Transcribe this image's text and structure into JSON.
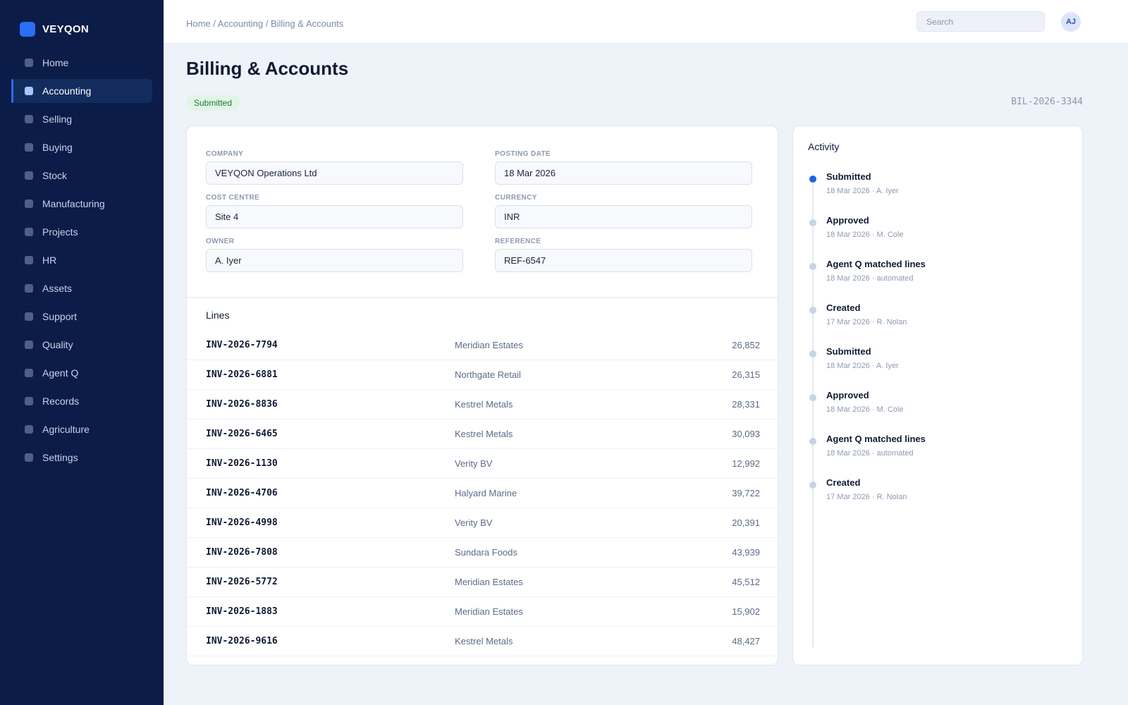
{
  "brand": {
    "name": "VEYQON"
  },
  "sidebar": {
    "items": [
      {
        "label": "Home"
      },
      {
        "label": "Accounting"
      },
      {
        "label": "Selling"
      },
      {
        "label": "Buying"
      },
      {
        "label": "Stock"
      },
      {
        "label": "Manufacturing"
      },
      {
        "label": "Projects"
      },
      {
        "label": "HR"
      },
      {
        "label": "Assets"
      },
      {
        "label": "Support"
      },
      {
        "label": "Quality"
      },
      {
        "label": "Agent Q"
      },
      {
        "label": "Records"
      },
      {
        "label": "Agriculture"
      },
      {
        "label": "Settings"
      }
    ],
    "active_index": 1
  },
  "topbar": {
    "breadcrumb": "Home / Accounting / Billing & Accounts",
    "search_placeholder": "Search",
    "avatar_initials": "AJ"
  },
  "page": {
    "title": "Billing & Accounts",
    "status": "Submitted",
    "doc_id": "BIL-2026-3344"
  },
  "form": {
    "company_label": "COMPANY",
    "company_value": "VEYQON Operations Ltd",
    "posting_date_label": "POSTING DATE",
    "posting_date_value": "18 Mar 2026",
    "cost_centre_label": "COST CENTRE",
    "cost_centre_value": "Site 4",
    "currency_label": "CURRENCY",
    "currency_value": "INR",
    "owner_label": "OWNER",
    "owner_value": "A. Iyer",
    "reference_label": "REFERENCE",
    "reference_value": "REF-6547"
  },
  "lines": {
    "title": "Lines",
    "rows": [
      {
        "invoice": "INV-2026-7794",
        "customer": "Meridian Estates",
        "amount": "26,852"
      },
      {
        "invoice": "INV-2026-6881",
        "customer": "Northgate Retail",
        "amount": "26,315"
      },
      {
        "invoice": "INV-2026-8836",
        "customer": "Kestrel Metals",
        "amount": "28,331"
      },
      {
        "invoice": "INV-2026-6465",
        "customer": "Kestrel Metals",
        "amount": "30,093"
      },
      {
        "invoice": "INV-2026-1130",
        "customer": "Verity BV",
        "amount": "12,992"
      },
      {
        "invoice": "INV-2026-4706",
        "customer": "Halyard Marine",
        "amount": "39,722"
      },
      {
        "invoice": "INV-2026-4998",
        "customer": "Verity BV",
        "amount": "20,391"
      },
      {
        "invoice": "INV-2026-7808",
        "customer": "Sundara Foods",
        "amount": "43,939"
      },
      {
        "invoice": "INV-2026-5772",
        "customer": "Meridian Estates",
        "amount": "45,512"
      },
      {
        "invoice": "INV-2026-1883",
        "customer": "Meridian Estates",
        "amount": "15,902"
      },
      {
        "invoice": "INV-2026-9616",
        "customer": "Kestrel Metals",
        "amount": "48,427"
      }
    ]
  },
  "activity": {
    "title": "Activity",
    "events": [
      {
        "event": "Submitted",
        "meta": "18 Mar 2026 · A. Iyer",
        "current": true
      },
      {
        "event": "Approved",
        "meta": "18 Mar 2026 · M. Cole",
        "current": false
      },
      {
        "event": "Agent Q matched lines",
        "meta": "18 Mar 2026 · automated",
        "current": false
      },
      {
        "event": "Created",
        "meta": "17 Mar 2026 · R. Nolan",
        "current": false
      },
      {
        "event": "Submitted",
        "meta": "18 Mar 2026 · A. Iyer",
        "current": false
      },
      {
        "event": "Approved",
        "meta": "18 Mar 2026 · M. Cole",
        "current": false
      },
      {
        "event": "Agent Q matched lines",
        "meta": "18 Mar 2026 · automated",
        "current": false
      },
      {
        "event": "Created",
        "meta": "17 Mar 2026 · R. Nolan",
        "current": false
      }
    ]
  },
  "colors": {
    "sidebar_bg": "#0b1c48",
    "accent": "#2b6ef5",
    "status_bg": "#e2f4e6",
    "status_text": "#1c7a3a"
  }
}
